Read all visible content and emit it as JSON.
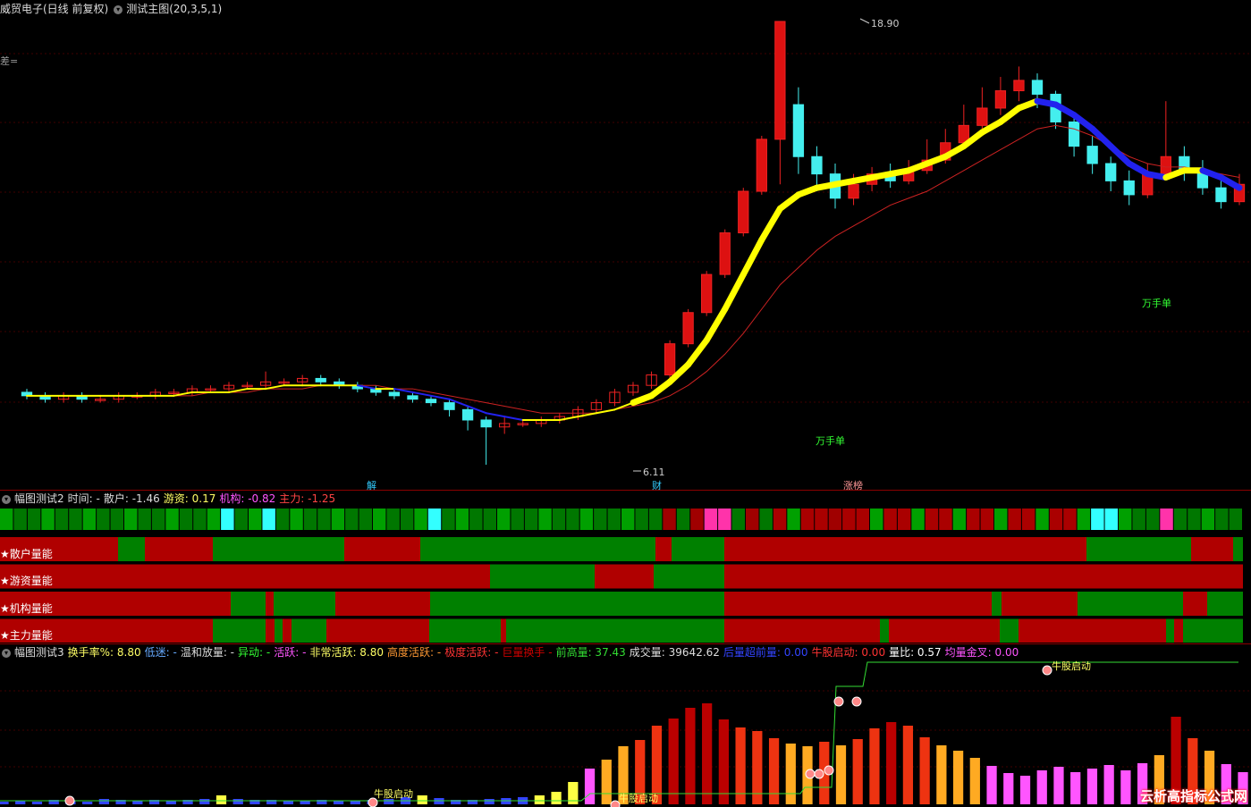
{
  "main_header": {
    "stock": "威贸电子(日线 前复权)",
    "indicator": "测试主图(20,3,5,1)",
    "diff_label": "差="
  },
  "main_chart": {
    "high_label": "18.90",
    "low_label": "6.11",
    "annotation_1": "万手单",
    "annotation_2": "万手单",
    "bottom_markers": {
      "left": "解",
      "mid": "财",
      "right": "涨榜"
    }
  },
  "panel2": {
    "title": "幅图测试2",
    "fields": [
      {
        "label": "时间:",
        "value": "-",
        "color": "#dddddd"
      },
      {
        "label": "散户:",
        "value": "-1.46",
        "color": "#dddddd"
      },
      {
        "label": "游资:",
        "value": "0.17",
        "color": "#ffff66"
      },
      {
        "label": "机构:",
        "value": "-0.82",
        "color": "#ff55ff"
      },
      {
        "label": "主力:",
        "value": "-1.25",
        "color": "#ff4444"
      }
    ],
    "rows": [
      {
        "label": "★散户量能"
      },
      {
        "label": "★游资量能"
      },
      {
        "label": "★机构量能"
      },
      {
        "label": "★主力量能"
      }
    ]
  },
  "panel3": {
    "title": "幅图测试3",
    "fields": [
      {
        "label": "换手率%:",
        "value": "8.80",
        "color": "#ffff66"
      },
      {
        "label": "低迷:",
        "value": "-",
        "color": "#66aaff"
      },
      {
        "label": "温和放量:",
        "value": "-",
        "color": "#dddddd"
      },
      {
        "label": "异动:",
        "value": "-",
        "color": "#33ff33"
      },
      {
        "label": "活跃:",
        "value": "-",
        "color": "#ff55ff"
      },
      {
        "label": "非常活跃:",
        "value": "8.80",
        "color": "#ffff66"
      },
      {
        "label": "高度活跃:",
        "value": "-",
        "color": "#ff9933"
      },
      {
        "label": "极度活跃:",
        "value": "-",
        "color": "#ff3333"
      },
      {
        "label": "巨量换手",
        "value": "-",
        "color": "#cc0000"
      },
      {
        "label": "前高量:",
        "value": "37.43",
        "color": "#33dd33"
      },
      {
        "label": "成交量:",
        "value": "39642.62",
        "color": "#dddddd"
      },
      {
        "label": "后量超前量:",
        "value": "0.00",
        "color": "#3344ff"
      },
      {
        "label": "牛股启动:",
        "value": "0.00",
        "color": "#ff3333"
      },
      {
        "label": "量比:",
        "value": "0.57",
        "color": "#ffffff"
      },
      {
        "label": "均量金叉:",
        "value": "0.00",
        "color": "#ff55ff"
      }
    ],
    "signals": [
      "牛股启动",
      "牛股启动",
      "牛股启动"
    ],
    "watermark": "云析高指标公式网"
  },
  "chart_data": {
    "type": "candlestick",
    "price_high": 18.9,
    "price_low": 6.11,
    "candles": [
      [
        8.2,
        8.1,
        8.3,
        8.0
      ],
      [
        8.1,
        8.0,
        8.2,
        7.9
      ],
      [
        8.0,
        8.1,
        8.2,
        7.9
      ],
      [
        8.1,
        8.0,
        8.2,
        7.9
      ],
      [
        8.0,
        8.0,
        8.1,
        7.9
      ],
      [
        8.0,
        8.1,
        8.2,
        7.9
      ],
      [
        8.1,
        8.1,
        8.2,
        8.0
      ],
      [
        8.1,
        8.2,
        8.3,
        8.0
      ],
      [
        8.2,
        8.2,
        8.3,
        8.1
      ],
      [
        8.2,
        8.3,
        8.4,
        8.1
      ],
      [
        8.3,
        8.3,
        8.4,
        8.2
      ],
      [
        8.3,
        8.4,
        8.5,
        8.2
      ],
      [
        8.4,
        8.4,
        8.5,
        8.3
      ],
      [
        8.4,
        8.5,
        8.8,
        8.3
      ],
      [
        8.5,
        8.5,
        8.6,
        8.4
      ],
      [
        8.5,
        8.6,
        8.7,
        8.4
      ],
      [
        8.6,
        8.5,
        8.7,
        8.4
      ],
      [
        8.5,
        8.4,
        8.6,
        8.3
      ],
      [
        8.4,
        8.3,
        8.5,
        8.2
      ],
      [
        8.3,
        8.2,
        8.4,
        8.1
      ],
      [
        8.2,
        8.1,
        8.3,
        8.0
      ],
      [
        8.1,
        8.0,
        8.2,
        7.9
      ],
      [
        8.0,
        7.9,
        8.1,
        7.8
      ],
      [
        7.9,
        7.7,
        8.0,
        7.5
      ],
      [
        7.7,
        7.4,
        7.8,
        7.1
      ],
      [
        7.4,
        7.2,
        7.5,
        6.11
      ],
      [
        7.2,
        7.3,
        7.5,
        7.0
      ],
      [
        7.3,
        7.3,
        7.4,
        7.2
      ],
      [
        7.3,
        7.4,
        7.5,
        7.2
      ],
      [
        7.4,
        7.5,
        7.6,
        7.3
      ],
      [
        7.5,
        7.7,
        7.8,
        7.4
      ],
      [
        7.7,
        7.9,
        8.0,
        7.6
      ],
      [
        7.9,
        8.2,
        8.3,
        7.8
      ],
      [
        8.2,
        8.4,
        8.5,
        8.1
      ],
      [
        8.4,
        8.7,
        8.8,
        8.3
      ],
      [
        8.7,
        9.6,
        9.7,
        8.6
      ],
      [
        9.6,
        10.5,
        10.6,
        9.5
      ],
      [
        10.5,
        11.6,
        11.7,
        10.4
      ],
      [
        11.6,
        12.8,
        12.9,
        11.5
      ],
      [
        12.8,
        14.0,
        14.1,
        12.7
      ],
      [
        14.0,
        15.5,
        15.6,
        13.9
      ],
      [
        15.5,
        18.9,
        18.9,
        14.2
      ],
      [
        16.5,
        15.0,
        17.0,
        14.5
      ],
      [
        15.0,
        14.5,
        15.3,
        14.0
      ],
      [
        14.5,
        13.8,
        14.8,
        13.5
      ],
      [
        13.8,
        14.2,
        14.5,
        13.6
      ],
      [
        14.2,
        14.5,
        14.7,
        14.0
      ],
      [
        14.5,
        14.3,
        14.8,
        14.1
      ],
      [
        14.3,
        14.6,
        14.9,
        14.2
      ],
      [
        14.6,
        14.9,
        15.5,
        14.5
      ],
      [
        14.9,
        15.4,
        15.8,
        14.8
      ],
      [
        15.4,
        15.9,
        16.5,
        15.2
      ],
      [
        15.9,
        16.4,
        17.0,
        15.7
      ],
      [
        16.4,
        16.9,
        17.3,
        16.2
      ],
      [
        16.9,
        17.2,
        17.6,
        16.6
      ],
      [
        17.2,
        16.8,
        17.4,
        16.4
      ],
      [
        16.8,
        16.0,
        16.9,
        15.8
      ],
      [
        16.0,
        15.3,
        16.2,
        15.0
      ],
      [
        15.3,
        14.8,
        15.6,
        14.5
      ],
      [
        14.8,
        14.3,
        15.0,
        14.0
      ],
      [
        14.3,
        13.9,
        14.6,
        13.6
      ],
      [
        13.9,
        14.5,
        14.8,
        13.8
      ],
      [
        14.5,
        15.0,
        16.6,
        14.4
      ],
      [
        15.0,
        14.6,
        15.3,
        14.3
      ],
      [
        14.6,
        14.1,
        14.9,
        13.9
      ],
      [
        14.1,
        13.7,
        14.3,
        13.5
      ],
      [
        13.7,
        14.2,
        14.5,
        13.6
      ]
    ],
    "ma_main": [
      8.1,
      8.1,
      8.1,
      8.1,
      8.1,
      8.1,
      8.1,
      8.1,
      8.1,
      8.2,
      8.2,
      8.2,
      8.3,
      8.3,
      8.4,
      8.4,
      8.4,
      8.4,
      8.4,
      8.3,
      8.3,
      8.2,
      8.1,
      8.0,
      7.8,
      7.6,
      7.5,
      7.4,
      7.4,
      7.4,
      7.5,
      7.6,
      7.7,
      7.9,
      8.1,
      8.5,
      9.0,
      9.7,
      10.6,
      11.6,
      12.6,
      13.5,
      13.9,
      14.1,
      14.2,
      14.3,
      14.4,
      14.5,
      14.6,
      14.8,
      15.0,
      15.3,
      15.7,
      16.0,
      16.4,
      16.6,
      16.5,
      16.2,
      15.8,
      15.3,
      14.8,
      14.5,
      14.4,
      14.6,
      14.6,
      14.4,
      14.1
    ],
    "ma_slow": [
      8.1,
      8.1,
      8.1,
      8.1,
      8.1,
      8.1,
      8.1,
      8.1,
      8.1,
      8.1,
      8.2,
      8.2,
      8.2,
      8.3,
      8.3,
      8.3,
      8.4,
      8.4,
      8.4,
      8.4,
      8.3,
      8.3,
      8.2,
      8.1,
      8.0,
      7.9,
      7.8,
      7.7,
      7.6,
      7.6,
      7.6,
      7.6,
      7.7,
      7.8,
      7.9,
      8.1,
      8.4,
      8.8,
      9.3,
      9.9,
      10.6,
      11.3,
      11.8,
      12.3,
      12.7,
      13.0,
      13.3,
      13.6,
      13.8,
      14.0,
      14.3,
      14.6,
      14.9,
      15.2,
      15.5,
      15.8,
      15.9,
      15.8,
      15.6,
      15.3,
      15.0,
      14.8,
      14.7,
      14.7,
      14.6,
      14.5,
      14.4
    ],
    "turnover": [
      0.3,
      0.4,
      0.3,
      0.5,
      0.4,
      0.3,
      0.6,
      0.5,
      0.4,
      0.5,
      0.4,
      0.5,
      0.6,
      1.0,
      0.6,
      0.5,
      0.5,
      0.4,
      0.4,
      0.5,
      0.4,
      0.4,
      0.5,
      0.6,
      0.8,
      1.0,
      0.7,
      0.5,
      0.5,
      0.6,
      0.7,
      0.8,
      1.0,
      1.4,
      2.5,
      4.0,
      5.0,
      6.5,
      7.2,
      8.8,
      9.6,
      10.8,
      11.3,
      9.5,
      8.6,
      8.2,
      7.4,
      6.8,
      6.5,
      7.0,
      6.6,
      7.3,
      8.5,
      9.2,
      8.8,
      7.5,
      6.6,
      6.0,
      5.2,
      4.3,
      3.5,
      3.2,
      3.8,
      4.2,
      3.6,
      4.0,
      4.4,
      3.8,
      4.6,
      5.5,
      9.8,
      7.4,
      6.0,
      4.5,
      3.6
    ],
    "panel2_strip_colors": [
      "#007700",
      "#00a000",
      "#ff33aa",
      "#33ffff"
    ],
    "panel2_row_colors": {
      "red": "#b00000",
      "green": "#008000"
    }
  }
}
